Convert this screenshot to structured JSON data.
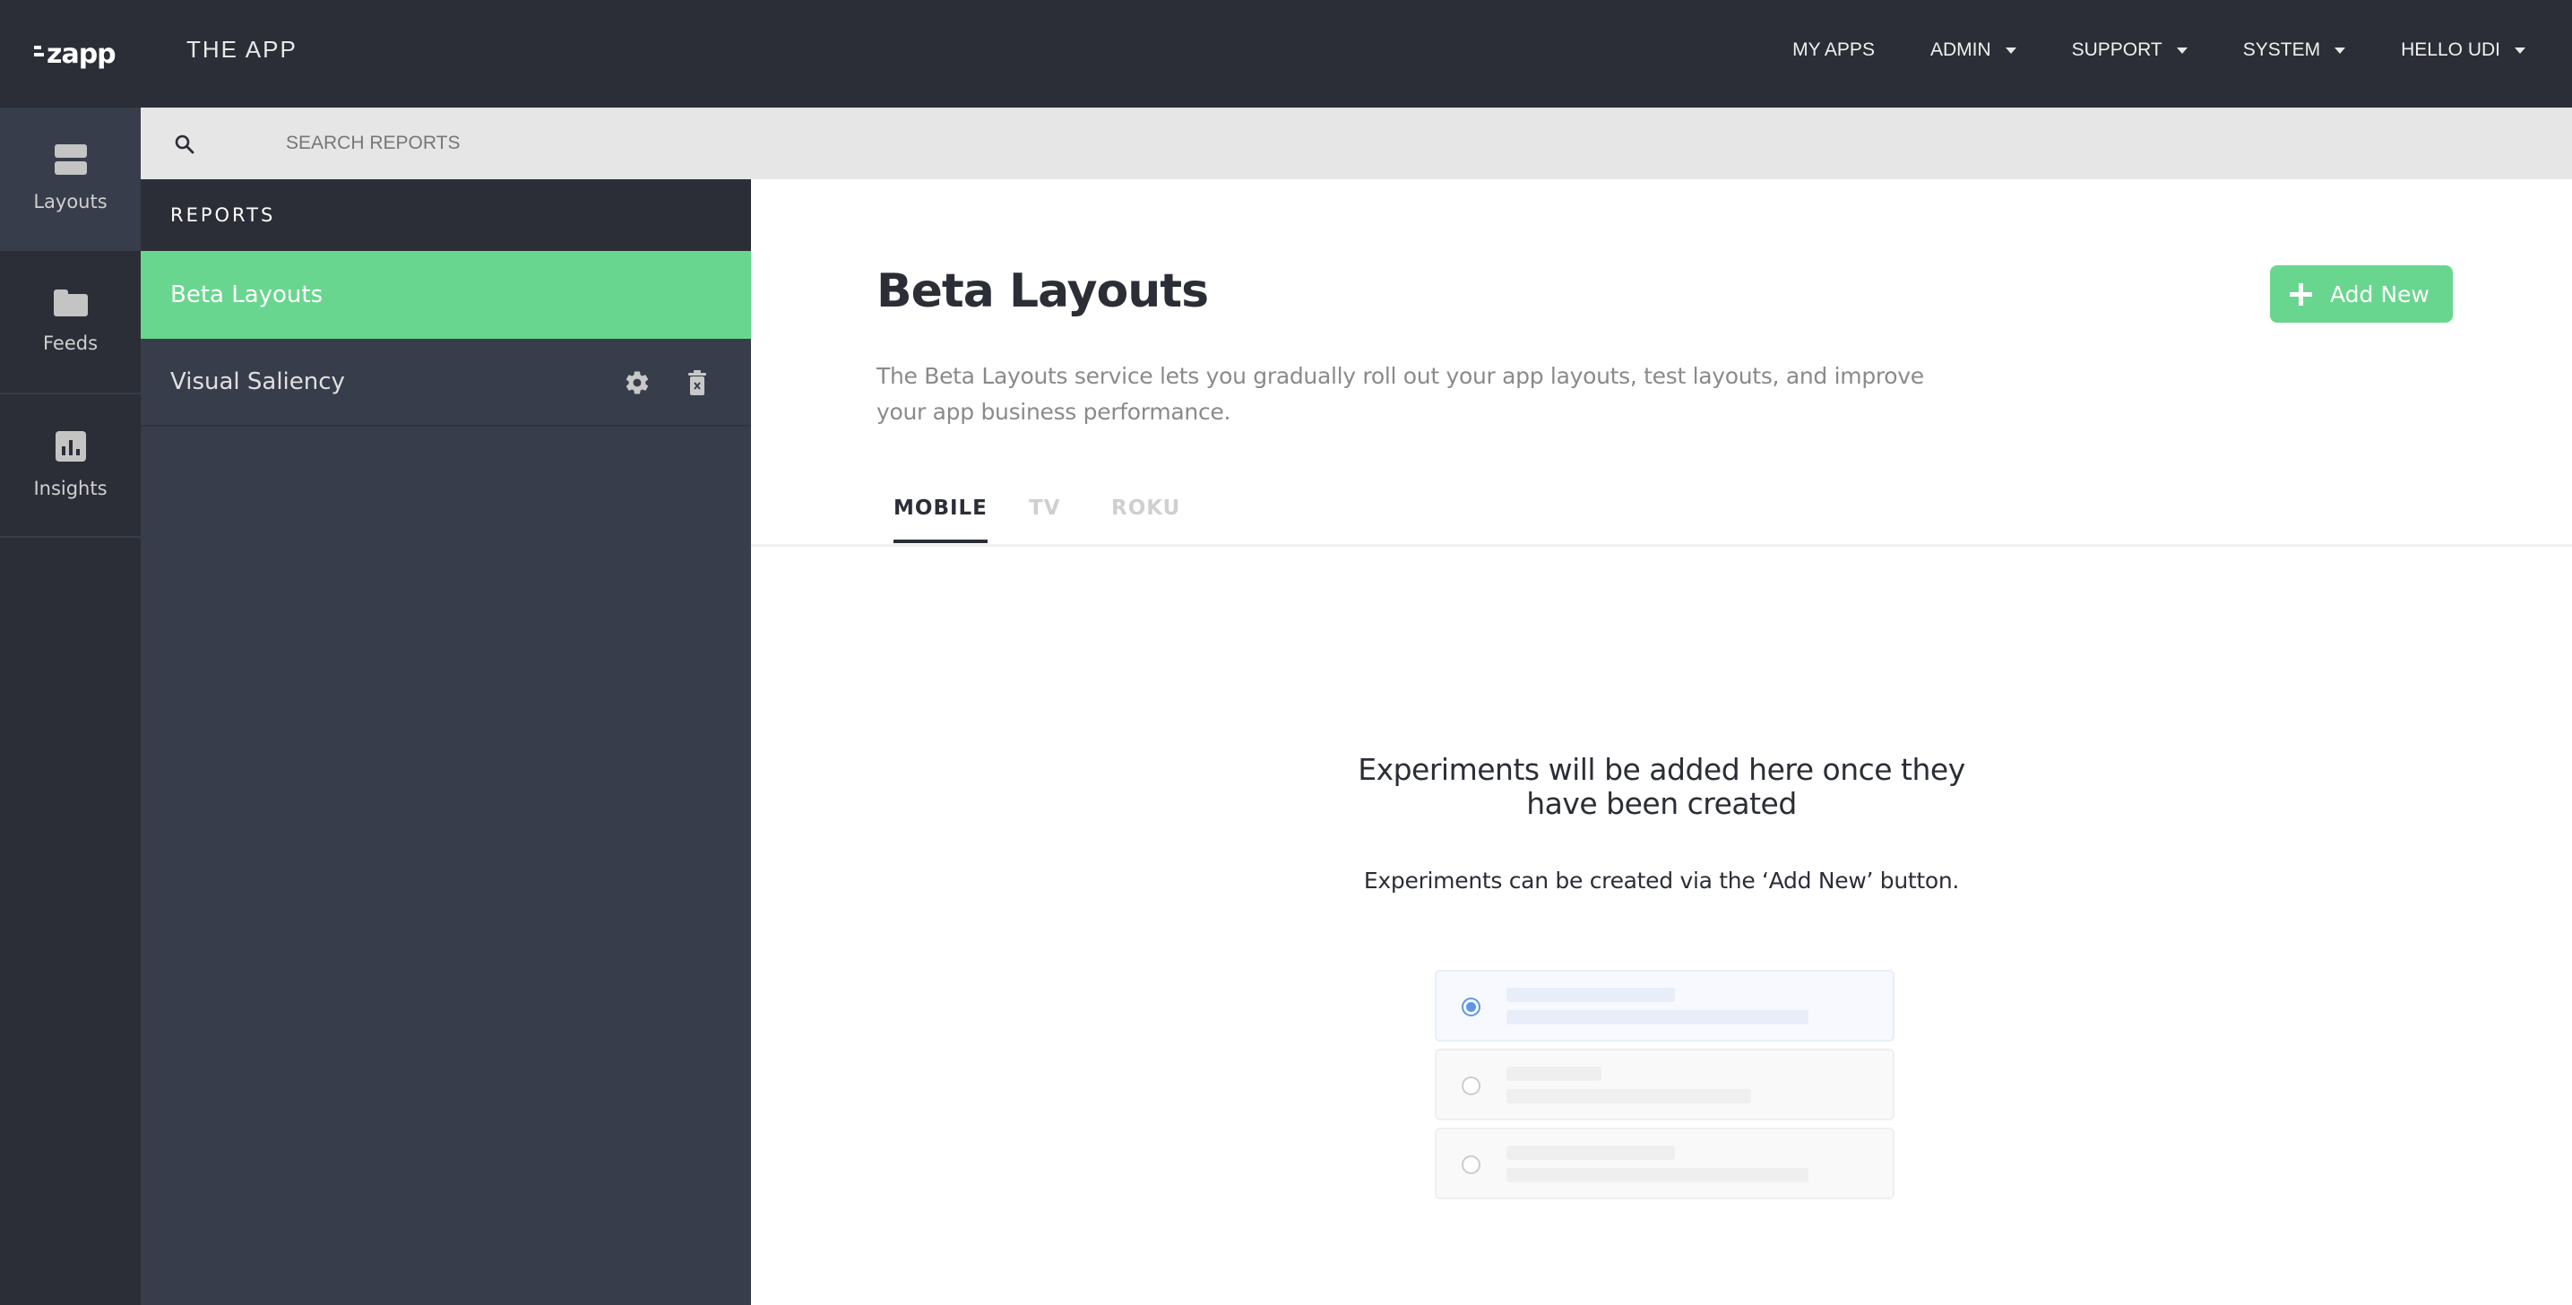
{
  "header": {
    "logo": "zapp",
    "app_title": "THE APP",
    "nav": [
      {
        "label": "MY APPS",
        "dropdown": false
      },
      {
        "label": "ADMIN",
        "dropdown": true
      },
      {
        "label": "SUPPORT",
        "dropdown": true
      },
      {
        "label": "SYSTEM",
        "dropdown": true
      },
      {
        "label": "HELLO UDI",
        "dropdown": true
      }
    ]
  },
  "sidebar": {
    "items": [
      {
        "label": "Layouts",
        "icon": "layouts-icon",
        "active": true
      },
      {
        "label": "Feeds",
        "icon": "folder-icon",
        "active": false
      },
      {
        "label": "Insights",
        "icon": "bar-chart-icon",
        "active": false
      }
    ]
  },
  "search": {
    "placeholder": "SEARCH REPORTS",
    "value": ""
  },
  "reports": {
    "header": "REPORTS",
    "items": [
      {
        "label": "Beta Layouts",
        "active": true
      },
      {
        "label": "Visual Saliency",
        "active": false,
        "actions": [
          "gear-icon",
          "trash-icon"
        ]
      }
    ]
  },
  "main": {
    "title": "Beta Layouts",
    "description": "The Beta Layouts service lets you gradually roll out your app layouts, test layouts, and improve your app business performance.",
    "add_button": "Add New",
    "tabs": [
      {
        "label": "MOBILE",
        "active": true
      },
      {
        "label": "TV",
        "active": false
      },
      {
        "label": "ROKU",
        "active": false
      }
    ],
    "empty_state": {
      "title": "Experiments will be added here once they have been created",
      "subtitle": "Experiments can be created via the ‘Add New’ button."
    }
  },
  "colors": {
    "header_bg": "#2b2e36",
    "panel_bg": "#373d4a",
    "accent_green": "#69d68f",
    "search_bg": "#e6e6e6",
    "radio_blue": "#5b95ef"
  }
}
